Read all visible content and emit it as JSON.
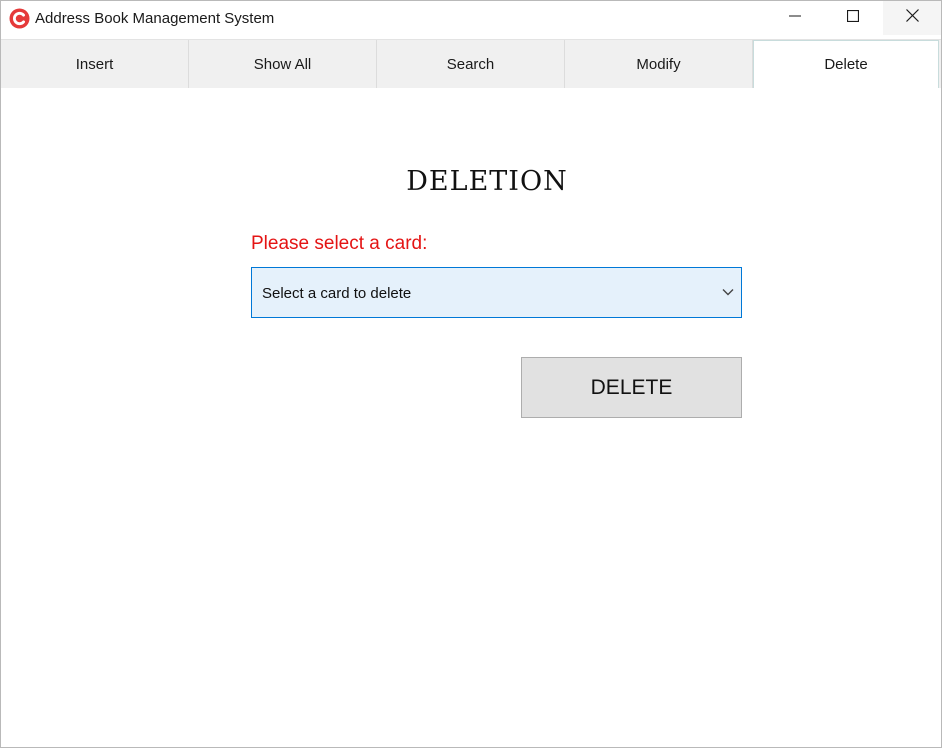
{
  "window": {
    "title": "Address Book Management System",
    "icon": "app-c-icon",
    "controls": [
      "minimize-icon",
      "maximize-icon",
      "close-icon"
    ]
  },
  "tabs": [
    {
      "label": "Insert",
      "active": false
    },
    {
      "label": "Show All",
      "active": false
    },
    {
      "label": "Search",
      "active": false
    },
    {
      "label": "Modify",
      "active": false
    },
    {
      "label": "Delete",
      "active": true
    }
  ],
  "main": {
    "heading": "DELETION",
    "prompt": "Please select a card:",
    "select": {
      "value": "Select a card to delete",
      "icon": "chevron-down-icon"
    },
    "delete_button": "DELETE"
  },
  "colors": {
    "prompt": "#e41414",
    "select_bg": "#e5f1fb",
    "select_border": "#0078d7",
    "button_bg": "#e1e1e1",
    "app_icon": "#e53a3a"
  }
}
